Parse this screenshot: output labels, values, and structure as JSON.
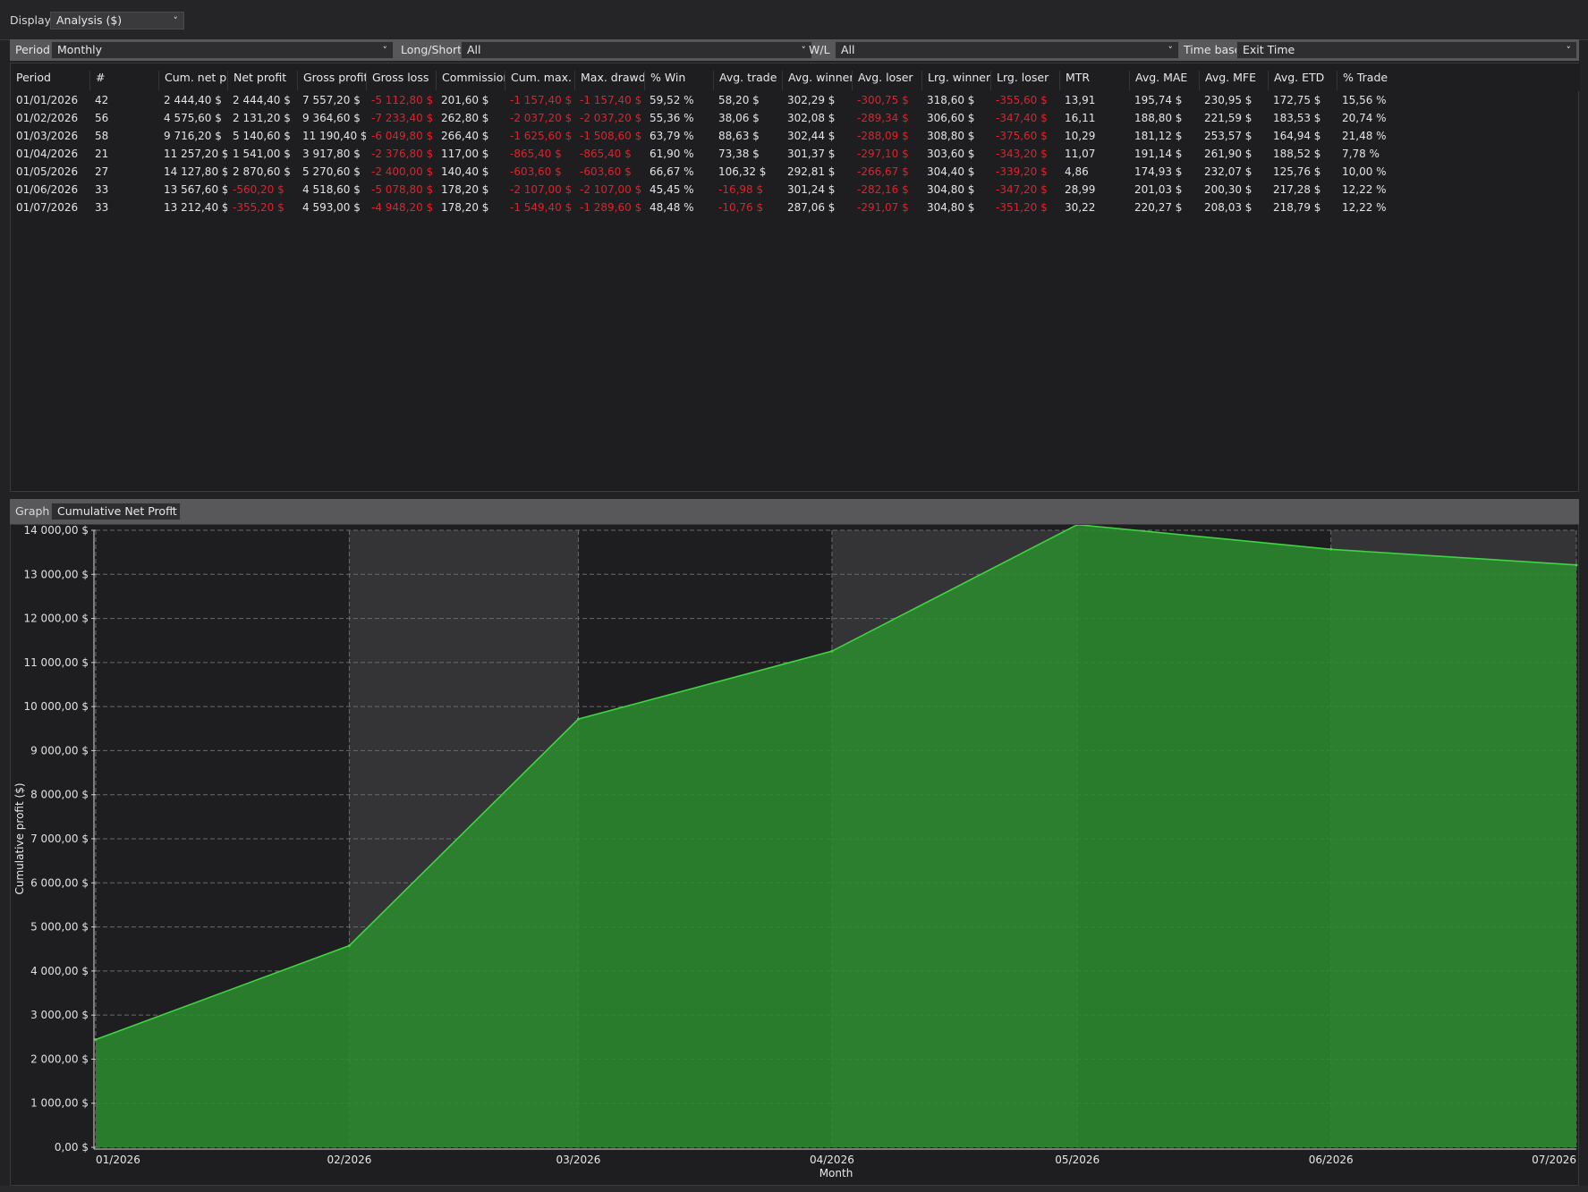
{
  "display": {
    "label": "Display",
    "value": "Analysis ($)"
  },
  "filters": {
    "period": {
      "label": "Period",
      "value": "Monthly"
    },
    "long_short": {
      "label": "Long/Short",
      "value": "All"
    },
    "wl": {
      "label": "W/L",
      "value": "All"
    },
    "time_base": {
      "label": "Time base",
      "value": "Exit Time"
    }
  },
  "table": {
    "headers": [
      "Period",
      "#",
      "Cum. net profi",
      "Net profit",
      "Gross profit",
      "Gross loss",
      "Commission",
      "Cum. max. dra",
      "Max. drawdow",
      "% Win",
      "Avg. trade",
      "Avg. winner",
      "Avg. loser",
      "Lrg. winner",
      "Lrg. loser",
      "MTR",
      "Avg. MAE",
      "Avg. MFE",
      "Avg. ETD",
      "% Trade"
    ],
    "rows": [
      [
        "01/01/2026",
        "42",
        "2 444,40 $",
        "2 444,40 $",
        "7 557,20 $",
        "-5 112,80 $",
        "201,60 $",
        "-1 157,40 $",
        "-1 157,40 $",
        "59,52 %",
        "58,20 $",
        "302,29 $",
        "-300,75 $",
        "318,60 $",
        "-355,60 $",
        "13,91",
        "195,74 $",
        "230,95 $",
        "172,75 $",
        "15,56 %"
      ],
      [
        "01/02/2026",
        "56",
        "4 575,60 $",
        "2 131,20 $",
        "9 364,60 $",
        "-7 233,40 $",
        "262,80 $",
        "-2 037,20 $",
        "-2 037,20 $",
        "55,36 %",
        "38,06 $",
        "302,08 $",
        "-289,34 $",
        "306,60 $",
        "-347,40 $",
        "16,11",
        "188,80 $",
        "221,59 $",
        "183,53 $",
        "20,74 %"
      ],
      [
        "01/03/2026",
        "58",
        "9 716,20 $",
        "5 140,60 $",
        "11 190,40 $",
        "-6 049,80 $",
        "266,40 $",
        "-1 625,60 $",
        "-1 508,60 $",
        "63,79 %",
        "88,63 $",
        "302,44 $",
        "-288,09 $",
        "308,80 $",
        "-375,60 $",
        "10,29",
        "181,12 $",
        "253,57 $",
        "164,94 $",
        "21,48 %"
      ],
      [
        "01/04/2026",
        "21",
        "11 257,20 $",
        "1 541,00 $",
        "3 917,80 $",
        "-2 376,80 $",
        "117,00 $",
        "-865,40 $",
        "-865,40 $",
        "61,90 %",
        "73,38 $",
        "301,37 $",
        "-297,10 $",
        "303,60 $",
        "-343,20 $",
        "11,07",
        "191,14 $",
        "261,90 $",
        "188,52 $",
        "7,78 %"
      ],
      [
        "01/05/2026",
        "27",
        "14 127,80 $",
        "2 870,60 $",
        "5 270,60 $",
        "-2 400,00 $",
        "140,40 $",
        "-603,60 $",
        "-603,60 $",
        "66,67 %",
        "106,32 $",
        "292,81 $",
        "-266,67 $",
        "304,40 $",
        "-339,20 $",
        "4,86",
        "174,93 $",
        "232,07 $",
        "125,76 $",
        "10,00 %"
      ],
      [
        "01/06/2026",
        "33",
        "13 567,60 $",
        "-560,20 $",
        "4 518,60 $",
        "-5 078,80 $",
        "178,20 $",
        "-2 107,00 $",
        "-2 107,00 $",
        "45,45 %",
        "-16,98 $",
        "301,24 $",
        "-282,16 $",
        "304,80 $",
        "-347,20 $",
        "28,99",
        "201,03 $",
        "200,30 $",
        "217,28 $",
        "12,22 %"
      ],
      [
        "01/07/2026",
        "33",
        "13 212,40 $",
        "-355,20 $",
        "4 593,00 $",
        "-4 948,20 $",
        "178,20 $",
        "-1 549,40 $",
        "-1 289,60 $",
        "48,48 %",
        "-10,76 $",
        "287,06 $",
        "-291,07 $",
        "304,80 $",
        "-351,20 $",
        "30,22",
        "220,27 $",
        "208,03 $",
        "218,79 $",
        "12,22 %"
      ]
    ]
  },
  "graph": {
    "label": "Graph",
    "value": "Cumulative Net Profit"
  },
  "colors": {
    "negative": "#e0202a",
    "area_fill": "#2a8a2e",
    "area_line": "#3fd442",
    "band_alt": "#343436"
  },
  "chart_data": {
    "type": "area",
    "xlabel": "Month",
    "ylabel": "Cumulative profit ($)",
    "categories": [
      "01/2026",
      "02/2026",
      "03/2026",
      "04/2026",
      "05/2026",
      "06/2026",
      "07/2026"
    ],
    "x_days": [
      0,
      31,
      59,
      90,
      120,
      151,
      181
    ],
    "values": [
      2444.4,
      4575.6,
      9716.2,
      11257.2,
      14127.8,
      13567.6,
      13212.4
    ],
    "ylim": [
      0,
      14000
    ],
    "yticks": [
      "0,00 $",
      "1 000,00 $",
      "2 000,00 $",
      "3 000,00 $",
      "4 000,00 $",
      "5 000,00 $",
      "6 000,00 $",
      "7 000,00 $",
      "8 000,00 $",
      "9 000,00 $",
      "10 000,00 $",
      "11 000,00 $",
      "12 000,00 $",
      "13 000,00 $",
      "14 000,00 $"
    ],
    "grid": true
  }
}
